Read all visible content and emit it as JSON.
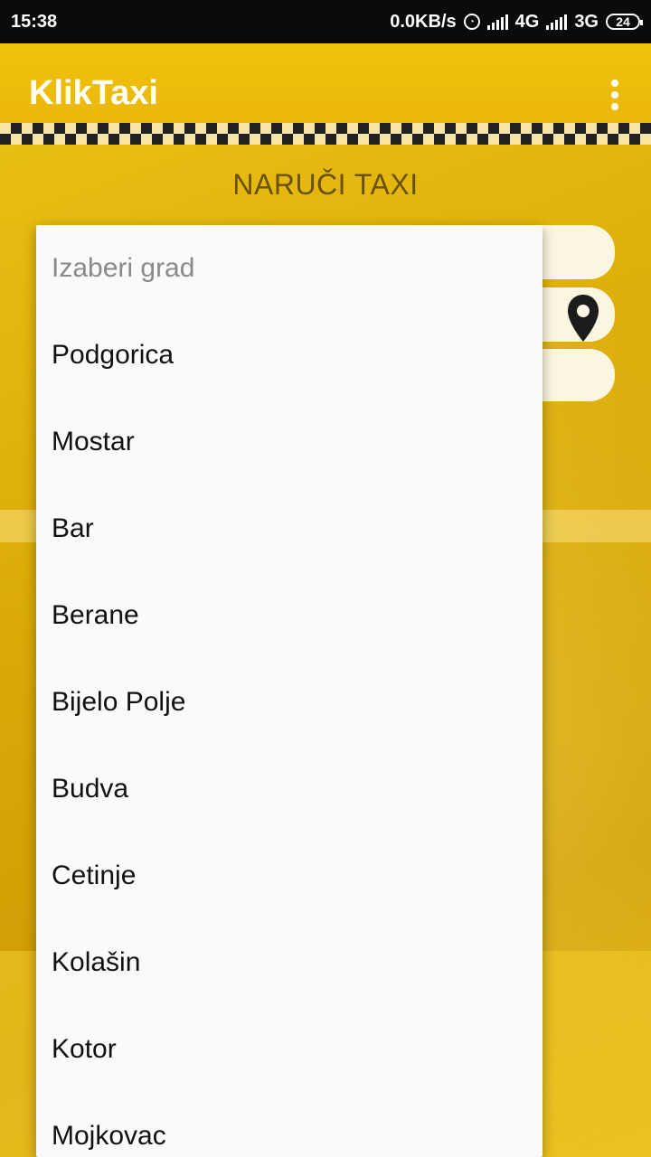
{
  "status_bar": {
    "time": "15:38",
    "net_speed": "0.0KB/s",
    "network1": "4G",
    "network2": "3G",
    "battery": "24"
  },
  "app_bar": {
    "title": "KlikTaxi"
  },
  "main": {
    "heading": "NARUČI TAXI"
  },
  "dropdown": {
    "hint": "Izaberi grad",
    "items": [
      "Podgorica",
      "Mostar",
      "Bar",
      "Berane",
      "Bijelo Polje",
      "Budva",
      "Cetinje",
      "Kolašin",
      "Kotor",
      "Mojkovac"
    ]
  },
  "colors": {
    "accent": "#eab70a",
    "dropdown_bg": "#fafafa"
  },
  "icons": [
    "alarm-icon",
    "signal-icon",
    "battery-icon",
    "more-vert-icon",
    "location-pin-icon"
  ]
}
